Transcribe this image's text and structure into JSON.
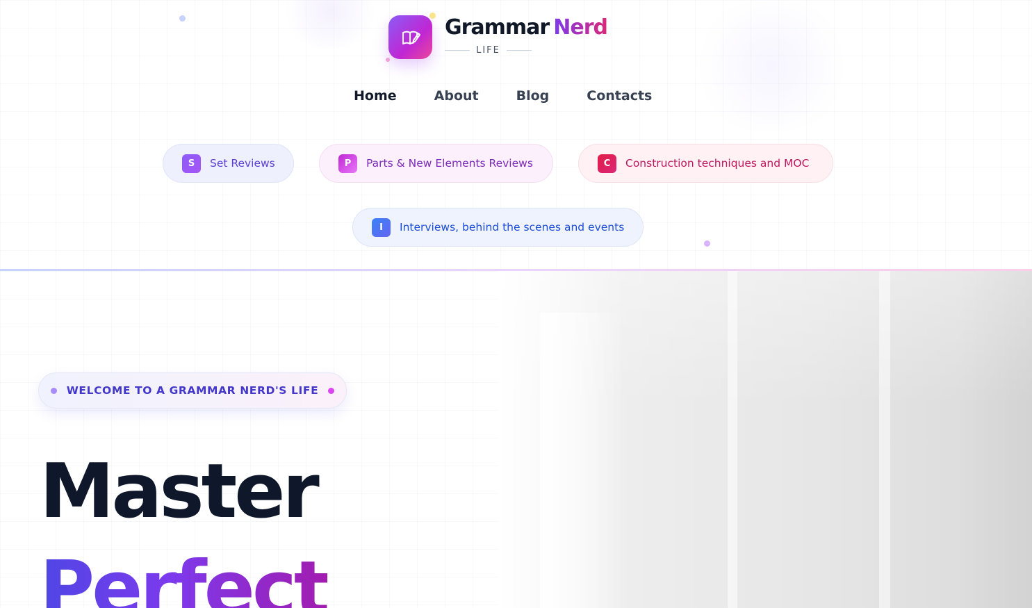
{
  "brand": {
    "name_part1": "Grammar",
    "name_part2": "Nerd",
    "tagline": "LIFE",
    "logo_icon": "open-book-with-pen-icon"
  },
  "nav": {
    "items": [
      {
        "label": "Home",
        "active": true
      },
      {
        "label": "About",
        "active": false
      },
      {
        "label": "Blog",
        "active": false
      },
      {
        "label": "Contacts",
        "active": false
      }
    ]
  },
  "categories": [
    {
      "badge": "S",
      "label": "Set Reviews",
      "color": "#8b5cf6"
    },
    {
      "badge": "P",
      "label": "Parts & New Elements Reviews",
      "color": "#c026d3"
    },
    {
      "badge": "C",
      "label": "Construction techniques and MOC",
      "color": "#e11d48"
    },
    {
      "badge": "I",
      "label": "Interviews, behind the scenes and events",
      "color": "#3b82f6"
    }
  ],
  "hero": {
    "eyebrow": "WELCOME TO A GRAMMAR NERD'S LIFE",
    "headline_line1": "Master",
    "headline_line2": "Perfect"
  },
  "colors": {
    "accent_purple": "#7c3aed",
    "accent_pink": "#db2777",
    "heading_dark": "#0f172a"
  }
}
